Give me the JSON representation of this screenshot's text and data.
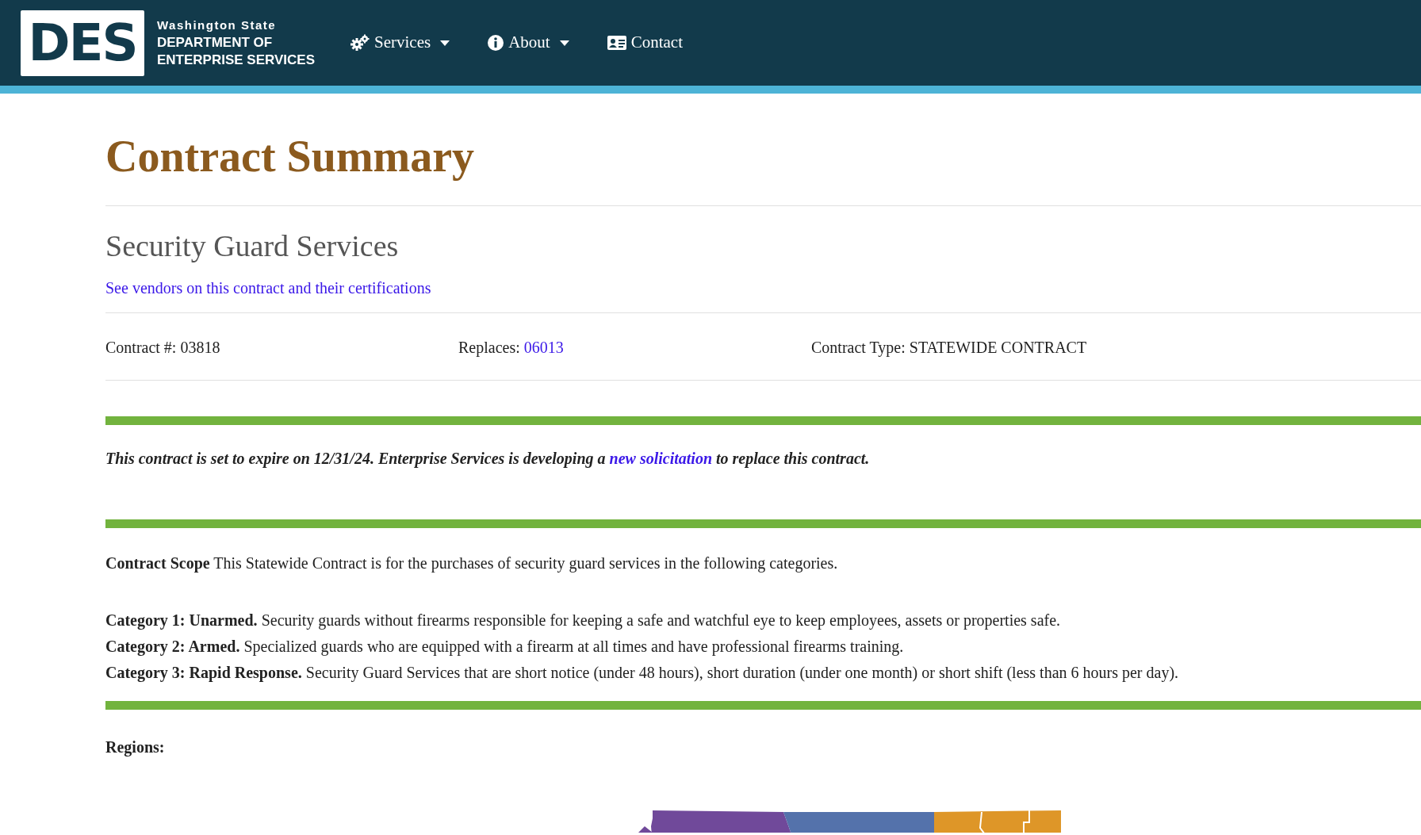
{
  "header": {
    "logo": "DES",
    "org_lines": [
      "Washington State",
      "DEPARTMENT OF",
      "ENTERPRISE SERVICES"
    ],
    "nav": [
      {
        "label": "Services",
        "kind": "dropdown"
      },
      {
        "label": "About",
        "kind": "dropdown"
      },
      {
        "label": "Contact",
        "kind": "link"
      }
    ]
  },
  "title": "Contract Summary",
  "subtitle": "Security Guard Services",
  "vendors_link": "See vendors on this contract and their certifications",
  "contract_info": {
    "number": "Contract #: 03818",
    "replaces_label": "Replaces:",
    "replaces_link": "06013",
    "type": "Contract Type: STATEWIDE CONTRACT"
  },
  "notice": {
    "before": "This contract is set to expire on 12/31/24. Enterprise Services is developing a",
    "link": "new solicitation",
    "after": "to replace this contract."
  },
  "scope": "**Contract Scope** This Statewide Contract is for the purchases of security guard services in the following categories.",
  "categories": [
    "**Category 1: Unarmed.** Security guards without firearms responsible for keeping a safe and watchful eye to keep employees, assets or properties safe.",
    "**Category 2: Armed.** Specialized guards who are equipped with a firearm at all times and have professional firearms training.",
    "**Category 3: Rapid Response.** Security Guard Services that are short notice (under 48 hours), short duration (under one month) or short shift (less than 6 hours per day)."
  ],
  "regions_label": "Regions:"
}
